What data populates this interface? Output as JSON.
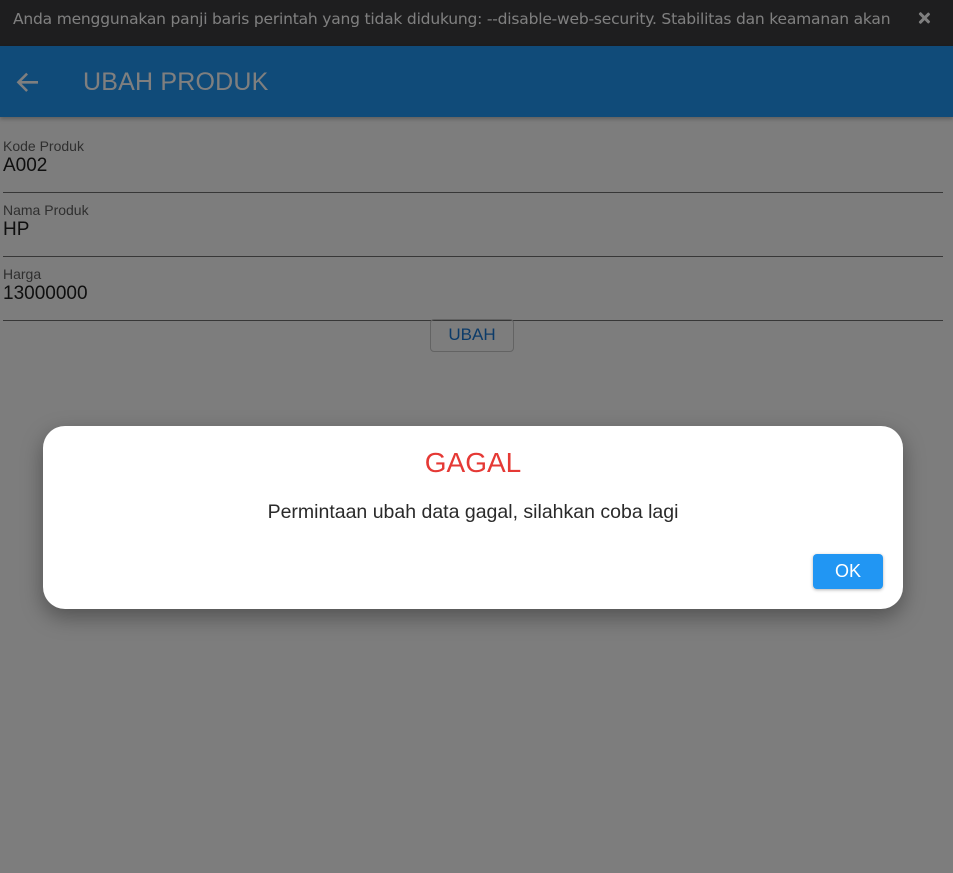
{
  "browser": {
    "infobar_text": "Anda menggunakan panji baris perintah yang tidak didukung: --disable-web-security. Stabilitas dan keamanan akan terg..."
  },
  "appbar": {
    "title": "UBAH PRODUK",
    "back_icon": "arrow-back-icon",
    "color": "#2196f3"
  },
  "form": {
    "fields": [
      {
        "label": "Kode Produk",
        "value": "A002"
      },
      {
        "label": "Nama Produk",
        "value": "HP"
      },
      {
        "label": "Harga",
        "value": "13000000"
      }
    ],
    "submit_label": "UBAH"
  },
  "dialog": {
    "title": "GAGAL",
    "message": "Permintaan ubah data gagal, silahkan coba lagi",
    "ok_label": "OK",
    "title_color": "#e53935",
    "button_color": "#2196f3"
  }
}
